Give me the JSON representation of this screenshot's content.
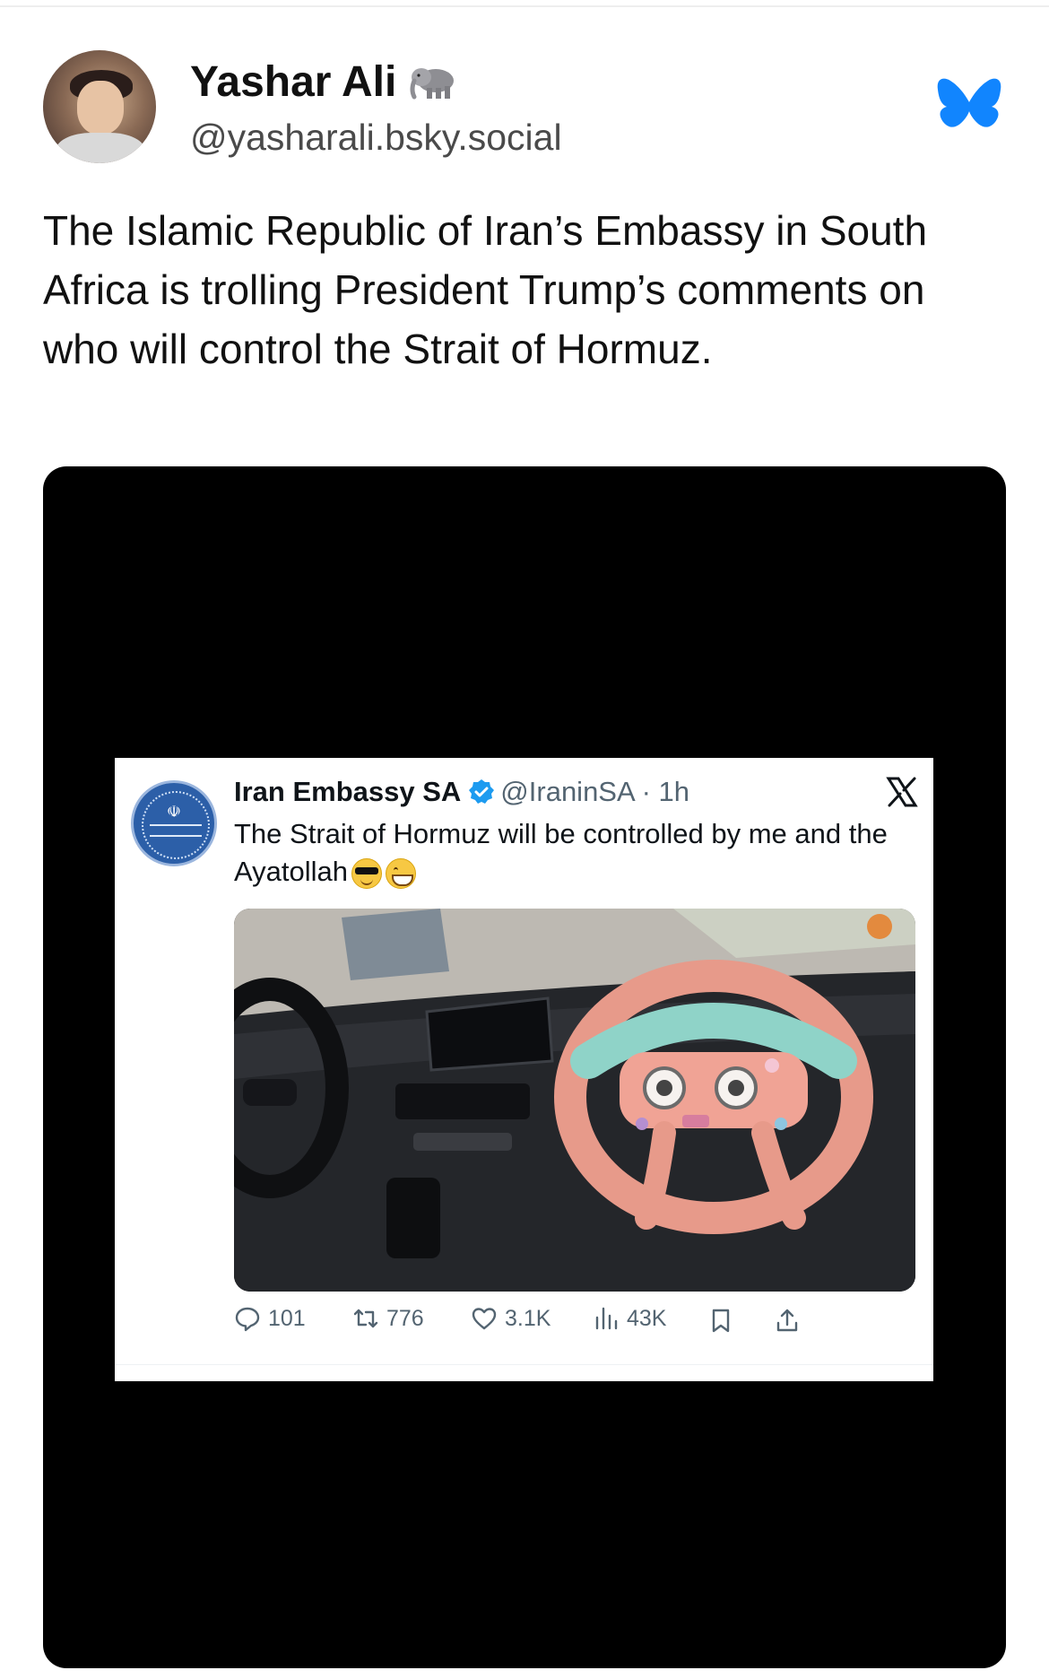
{
  "post": {
    "author": {
      "display_name": "Yashar Ali",
      "handle": "@yasharali.bsky.social",
      "name_icon": "elephant-emoji"
    },
    "platform_icon": "bluesky-butterfly-icon",
    "text": "The Islamic Republic of Iran’s Embassy in South Africa is trolling President Trump’s comments on who will control the Strait of Hormuz."
  },
  "embedded_tweet": {
    "name": "Iran Embassy SA",
    "handle_time": "@IraninSA · 1h",
    "verified": true,
    "text": "The Strait of Hormuz will be controlled by me and the Ayatollah",
    "emojis": [
      "smiling-face-with-sunglasses",
      "grinning-face-with-smiling-eyes"
    ],
    "image_description_icon": "toy-steering-wheel-photo",
    "metrics": {
      "replies": "101",
      "reposts": "776",
      "likes": "3.1K",
      "views": "43K"
    }
  },
  "colors": {
    "bluesky_blue": "#1185fe",
    "verified_blue": "#1d9bf0",
    "media_background": "#000000"
  }
}
